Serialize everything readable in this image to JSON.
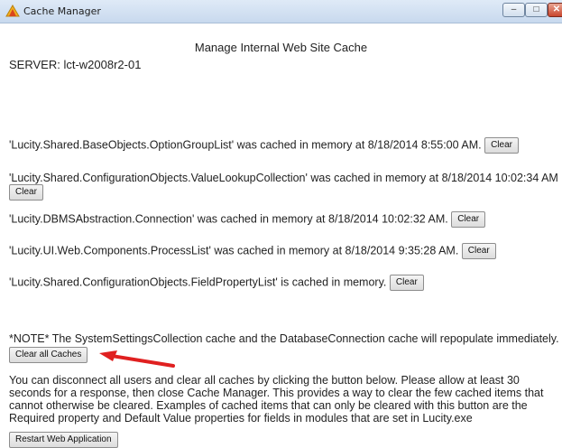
{
  "window": {
    "title": "Cache Manager",
    "minimize_glyph": "–",
    "maximize_glyph": "□",
    "close_glyph": "✕",
    "icon": "cache-manager-app-icon"
  },
  "page": {
    "heading": "Manage Internal Web Site Cache",
    "server_label": "SERVER: lct-w2008r2-01"
  },
  "cache_items": [
    {
      "text": "'Lucity.Shared.BaseObjects.OptionGroupList' was cached in memory at 8/18/2014 8:55:00 AM.",
      "button": "Clear"
    },
    {
      "text": "'Lucity.Shared.ConfigurationObjects.ValueLookupCollection' was cached in memory at 8/18/2014 10:02:34 AM",
      "button": "Clear"
    },
    {
      "text": "'Lucity.DBMSAbstraction.Connection' was cached in memory at 8/18/2014 10:02:32 AM.",
      "button": "Clear"
    },
    {
      "text": "'Lucity.UI.Web.Components.ProcessList' was cached in memory at 8/18/2014 9:35:28 AM.",
      "button": "Clear"
    },
    {
      "text": "'Lucity.Shared.ConfigurationObjects.FieldPropertyList' is cached in memory.",
      "button": "Clear"
    }
  ],
  "note": "*NOTE* The SystemSettingsCollection cache and the DatabaseConnection cache will repopulate immediately.",
  "clear_all_button": "Clear all Caches",
  "restart_paragraph": "You can disconnect all users and clear all caches by clicking the button below. Please allow at least 30 seconds for a response, then close Cache Manager. This provides a way to clear the few cached items that cannot otherwise be cleared. Examples of cached items that can only be cleared with this button are the Required property and Default Value properties for fields in modules that are set in Lucity.exe",
  "restart_button": "Restart Web Application",
  "colors": {
    "arrow": "#e02020",
    "titlebar": "#c8d9ee",
    "text": "#222222"
  }
}
